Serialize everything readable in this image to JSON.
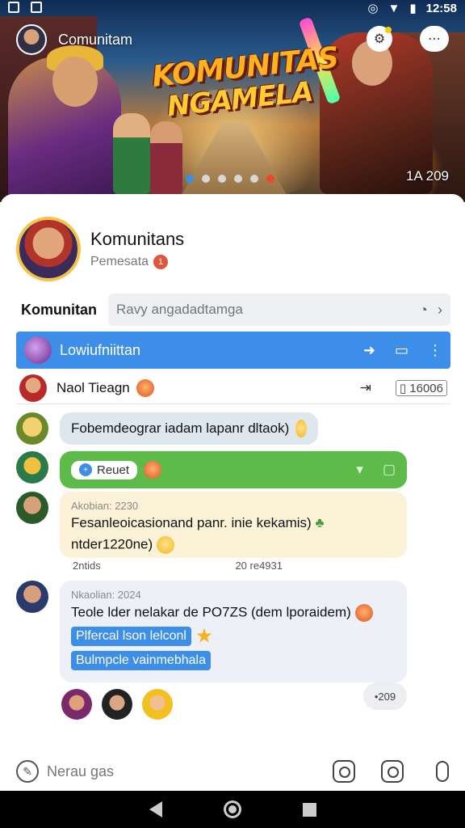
{
  "status_bar": {
    "time": "12:58"
  },
  "hero": {
    "community_name": "Comunitam",
    "banner_title_line1": "KOMUNITAS",
    "banner_title_line2": "NGAMELA",
    "count": "1A 209"
  },
  "profile": {
    "name": "Komunitans",
    "subtitle": "Pemesata",
    "badge": "1"
  },
  "tabs": {
    "active": "Komunitan"
  },
  "search": {
    "placeholder": "Ravy angadadtamga"
  },
  "list": {
    "selected": {
      "label": "Lowiufniittan"
    },
    "item": {
      "label": "Naol Tieagn",
      "count": "16006"
    }
  },
  "messages": [
    {
      "text": "Fobemdeograr iadam lapanr dltaok)"
    },
    {
      "pill": "Reuet"
    },
    {
      "meta": "Akobian: 2230",
      "line1": "Fesanleoicasionand panr. inie kekamis)",
      "line2": "ntder1220ne)"
    },
    {
      "meta": "Nkaolian: 2024",
      "text": "Teole lder nelakar de PO7ZS (dem lporaidem)",
      "tag1": "Plfercal lson lelconl",
      "tag2": "Bulmpcle vainmebhala"
    }
  ],
  "meta_row": {
    "left": "2ntids",
    "right": "20 re4931"
  },
  "reaction_count": "•209",
  "composer": {
    "placeholder": "Nerau gas"
  },
  "colors": {
    "accent": "#3d8ee8",
    "green": "#5dbb4a",
    "yellow_bubble": "#fbf2d8"
  },
  "icons": [
    "camera-icon",
    "video-icon",
    "mic-icon",
    "pen-icon",
    "search-icon",
    "chevron-right-icon",
    "share-icon",
    "more-icon"
  ]
}
